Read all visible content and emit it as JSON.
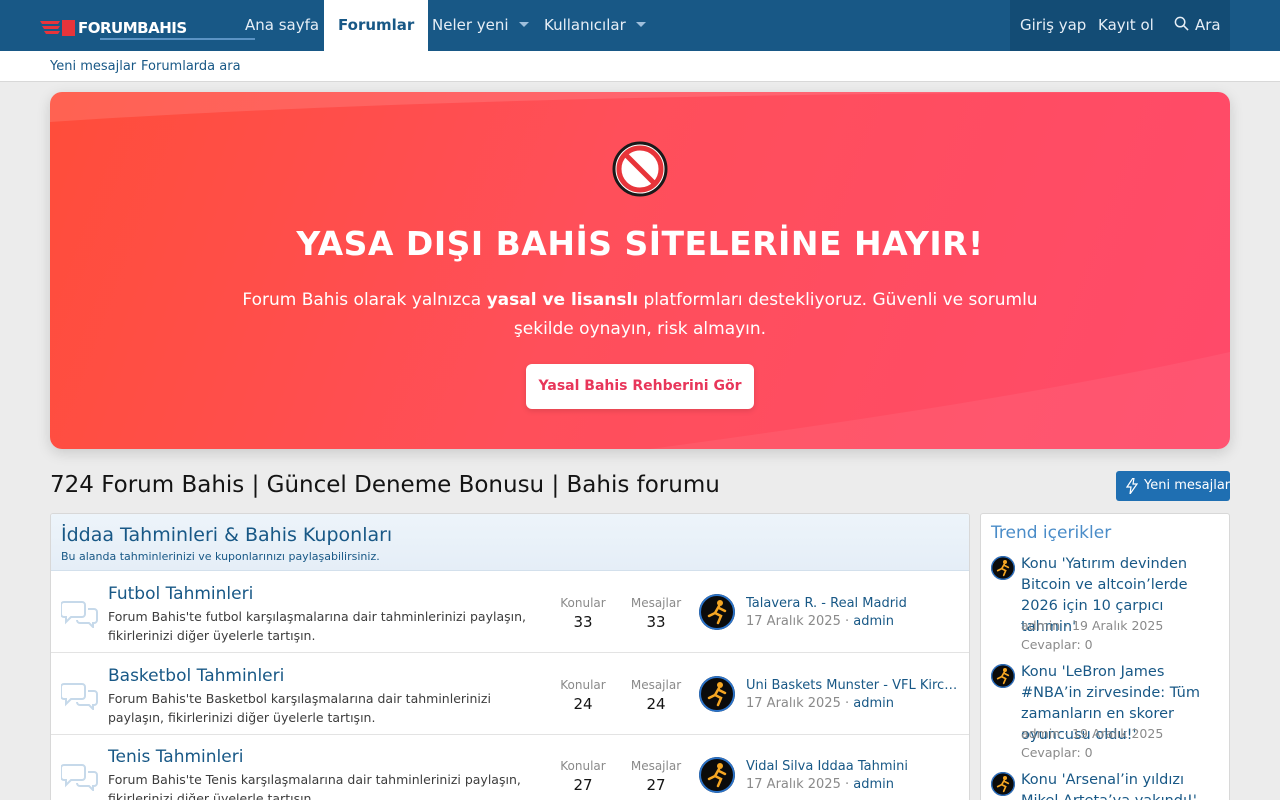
{
  "colors": {
    "nav_bg": "#185886",
    "accent": "#1f6fb2",
    "hero_start": "#ff4d3a",
    "hero_end": "#ff4a6a",
    "link": "#185886"
  },
  "brand": {
    "logo_text": "FORUMBAHIS",
    "logo_small": "7 24"
  },
  "nav": {
    "home": "Ana sayfa",
    "forums": "Forumlar",
    "whats_new": "Neler yeni",
    "members": "Kullanıcılar",
    "login": "Giriş yap",
    "register": "Kayıt ol",
    "search": "Ara"
  },
  "subnav": {
    "new_posts": "Yeni mesajlar",
    "search_forums": "Forumlarda ara"
  },
  "hero": {
    "icon": "no-entry-icon",
    "title": "YASA DIŞI BAHİS SİTELERİNE HAYIR!",
    "desc_pre": "Forum Bahis olarak yalnızca ",
    "desc_bold": "yasal ve lisanslı",
    "desc_post": " platformları destekliyoruz. Güvenli ve sorumlu şekilde oynayın, risk almayın.",
    "cta": "Yasal Bahis Rehberini Gör"
  },
  "page": {
    "title": "724 Forum Bahis | Güncel Deneme Bonusu | Bahis forumu",
    "new_posts_button": "Yeni mesajlar"
  },
  "category": {
    "title": "İddaa Tahminleri & Bahis Kuponları",
    "desc": "Bu alanda tahminlerinizi ve kuponlarınızı paylaşabilirsiniz.",
    "stat_labels": {
      "threads": "Konular",
      "messages": "Mesajlar"
    },
    "forums": [
      {
        "title": "Futbol Tahminleri",
        "desc": "Forum Bahis'te futbol karşılaşmalarına dair tahminlerinizi paylaşın, fikirlerinizi diğer üyelerle tartışın.",
        "threads": "33",
        "messages": "33",
        "last_title": "Talavera R. - Real Madrid",
        "last_date": "17 Aralık 2025",
        "last_user": "admin"
      },
      {
        "title": "Basketbol Tahminleri",
        "desc": "Forum Bahis'te Basketbol karşılaşmalarına dair tahminlerinizi paylaşın, fikirlerinizi diğer üyelerle tartışın.",
        "threads": "24",
        "messages": "24",
        "last_title": "Uni Baskets Munster - VFL Kirchheim Knights",
        "last_date": "17 Aralık 2025",
        "last_user": "admin"
      },
      {
        "title": "Tenis Tahminleri",
        "desc": "Forum Bahis'te Tenis karşılaşmalarına dair tahminlerinizi paylaşın, fikirlerinizi diğer üyelerle tartışın.",
        "threads": "27",
        "messages": "27",
        "last_title": "Vidal Silva İddaa Tahmini",
        "last_date": "17 Aralık 2025",
        "last_user": "admin"
      }
    ]
  },
  "sidebar": {
    "title": "Trend içerikler",
    "items": [
      {
        "title": "Konu 'Yatırım devinden Bitcoin ve altcoin’lerde 2026 için 10 çarpıcı tahmin'",
        "meta": "admin · 19 Aralık 2025",
        "replies": "Cevaplar: 0"
      },
      {
        "title": "Konu 'LeBron James #NBA’in zirvesinde: Tüm zamanların en skorer oyuncusu oldu!'",
        "meta": "admin · 19 Aralık 2025",
        "replies": "Cevaplar: 0"
      },
      {
        "title": "Konu 'Arsenal’in yıldızı Mikel Arteta’ya yakındı!'",
        "meta": "",
        "replies": ""
      }
    ]
  }
}
